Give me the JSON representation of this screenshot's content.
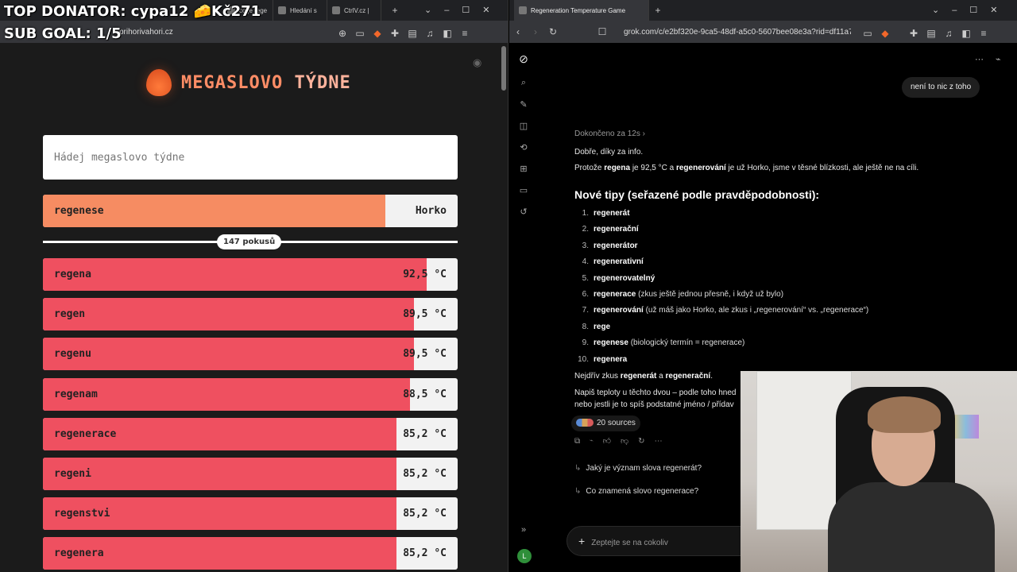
{
  "overlay": {
    "donator": "TOP DONATOR: cypa12 🧀Kč271",
    "goal": "SUB GOAL: 1/5"
  },
  "left_browser": {
    "tabs": [
      "co je rege",
      "Hledání s",
      "CtrlV.cz |"
    ],
    "url": "prihorivahori.cz"
  },
  "game": {
    "title_a": "MEGASLOVO",
    "title_b": "TÝDNE",
    "input_placeholder": "Hádej megaslovo týdne",
    "current": {
      "word": "regenese",
      "temp": "Horko",
      "fill": 0.825
    },
    "attempts": "147 pokusů",
    "guesses": [
      {
        "word": "regena",
        "temp": "92,5 °C",
        "fill": 0.925
      },
      {
        "word": "regen",
        "temp": "89,5 °C",
        "fill": 0.895
      },
      {
        "word": "regenu",
        "temp": "89,5 °C",
        "fill": 0.895
      },
      {
        "word": "regenam",
        "temp": "88,5 °C",
        "fill": 0.885
      },
      {
        "word": "regenerace",
        "temp": "85,2 °C",
        "fill": 0.852
      },
      {
        "word": "regeni",
        "temp": "85,2 °C",
        "fill": 0.852
      },
      {
        "word": "regenstvi",
        "temp": "85,2 °C",
        "fill": 0.852
      },
      {
        "word": "regenera",
        "temp": "85,2 °C",
        "fill": 0.852
      }
    ]
  },
  "right_browser": {
    "tab": "Regeneration Temperature Game",
    "url": "grok.com/c/e2bf320e-9ca5-48df-a5c0-5607bee08e3a?rid=df11a7f..."
  },
  "grok": {
    "user_msg": "není to nic z toho",
    "thought": "Dokončeno za 12s",
    "p1": "Dobře, díky za info.",
    "p2_a": "Protože ",
    "p2_b": "regena",
    "p2_c": " je 92,5 °C a ",
    "p2_d": "regenerování",
    "p2_e": " je už Horko, jsme v těsné blízkosti, ale ještě ne na cíli.",
    "heading": "Nové tipy (seřazené podle pravděpodobnosti):",
    "tips": [
      {
        "n": "1.",
        "b": "regenerát",
        "r": ""
      },
      {
        "n": "2.",
        "b": "regenerační",
        "r": ""
      },
      {
        "n": "3.",
        "b": "regenerátor",
        "r": ""
      },
      {
        "n": "4.",
        "b": "regenerativní",
        "r": ""
      },
      {
        "n": "5.",
        "b": "regenerovatelný",
        "r": ""
      },
      {
        "n": "6.",
        "b": "regenerace",
        "r": " (zkus ještě jednou přesně, i když už bylo)"
      },
      {
        "n": "7.",
        "b": "regenerování",
        "r": " (už máš jako Horko, ale zkus i „regenerování“ vs. „regenerace“)"
      },
      {
        "n": "8.",
        "b": "rege",
        "r": ""
      },
      {
        "n": "9.",
        "b": "regenese",
        "r": " (biologický termín = regenerace)"
      },
      {
        "n": "10.",
        "b": "regenera",
        "r": ""
      }
    ],
    "p3_a": "Nejdřív zkus ",
    "p3_b": "regenerát",
    "p3_c": " a ",
    "p3_d": "regenerační",
    "p3_e": ".",
    "p4": "Napiš teploty u těchto dvou – podle toho hned",
    "p5": "nebo jestli je to spíš podstatné jméno / přídav",
    "sources": "20 sources",
    "suggestions": [
      "Jaký je význam slova regenerát?",
      "Co znamená slovo regenerace?"
    ],
    "composer_placeholder": "Zeptejte se na cokoliv",
    "avatar": "L"
  }
}
